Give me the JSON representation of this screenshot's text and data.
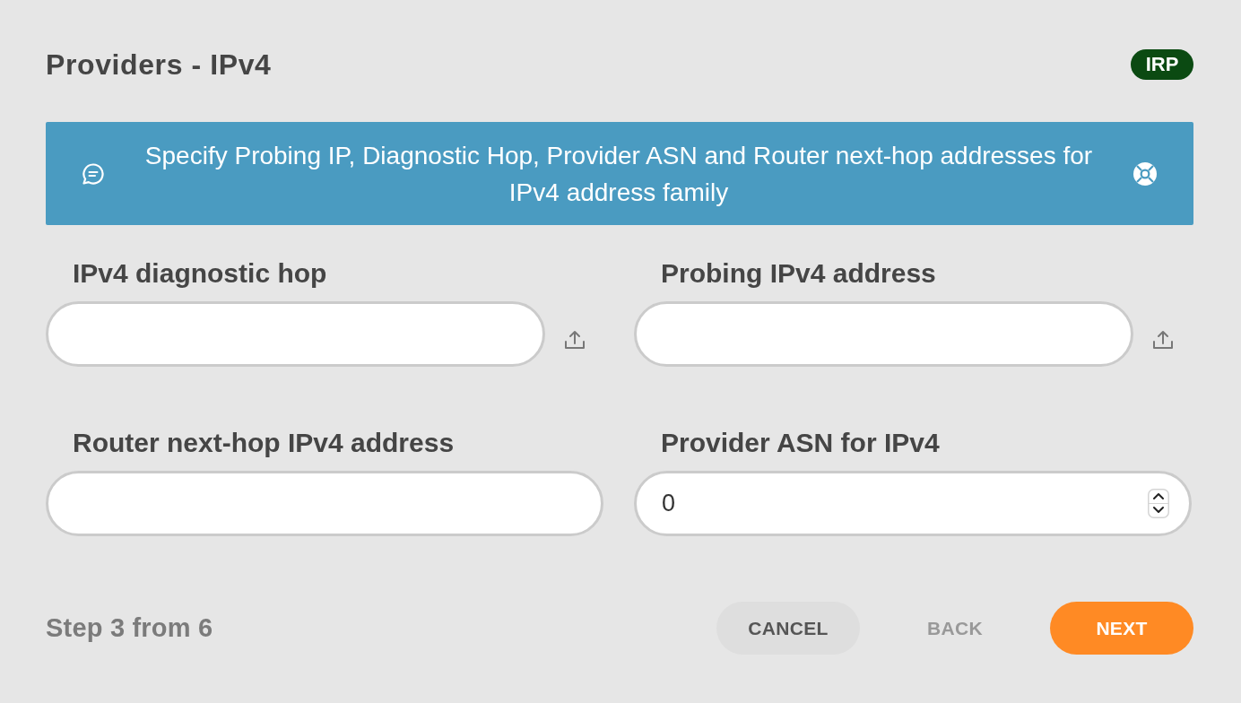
{
  "header": {
    "title": "Providers - IPv4",
    "badge": "IRP"
  },
  "banner": {
    "text": "Specify Probing IP, Diagnostic Hop, Provider ASN and Router next-hop addresses for IPv4 address family"
  },
  "fields": [
    {
      "label": "IPv4 diagnostic hop",
      "kind": "text",
      "upload": true
    },
    {
      "label": "Probing IPv4 address",
      "kind": "text",
      "upload": true
    },
    {
      "label": "Router next-hop IPv4 address",
      "kind": "text",
      "upload": false
    },
    {
      "label": "Provider ASN for IPv4",
      "kind": "number",
      "value": "0",
      "upload": false
    }
  ],
  "footer": {
    "step": "Step 3 from 6",
    "buttons": [
      {
        "label": "CANCEL",
        "kind": "secondary",
        "disabled": false
      },
      {
        "label": "BACK",
        "kind": "plain",
        "disabled": true
      },
      {
        "label": "NEXT",
        "kind": "primary",
        "disabled": false
      }
    ]
  }
}
